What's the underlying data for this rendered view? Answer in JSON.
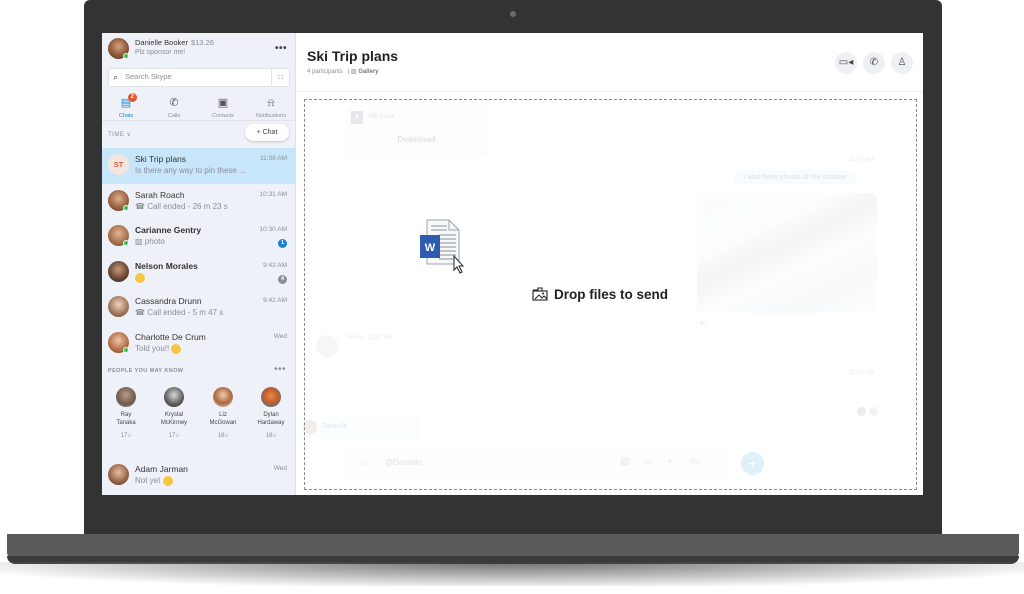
{
  "device": {
    "type": "laptop"
  },
  "profile": {
    "name": "Danielle Booker",
    "credit": "$13.26",
    "mood": "Plz sponsor me!",
    "more_icon": "ellipsis-icon",
    "more_label": "•••"
  },
  "search": {
    "placeholder": "Search Skype",
    "icon": "search-icon",
    "dialpad_icon": "dialpad-icon"
  },
  "nav_tabs": [
    {
      "label": "Chats",
      "icon": "chat-icon",
      "badge": "2",
      "active": true
    },
    {
      "label": "Calls",
      "icon": "phone-icon",
      "active": false
    },
    {
      "label": "Contacts",
      "icon": "contacts-icon",
      "active": false
    },
    {
      "label": "Notifications",
      "icon": "bell-icon",
      "active": false
    }
  ],
  "sort": {
    "label": "TIME",
    "new_chat_label": "+ Chat"
  },
  "chats": [
    {
      "name": "Ski Trip plans",
      "initials": "ST",
      "preview": "Is there any way to pin these ...",
      "time": "11:08 AM",
      "selected": true,
      "bold": false
    },
    {
      "name": "Sarah Roach",
      "preview": "Call ended - 26 m 23 s",
      "preview_icon": "call-ended-icon",
      "time": "10:31 AM",
      "online": true
    },
    {
      "name": "Carianne Gentry",
      "preview": "photo",
      "preview_icon": "image-icon",
      "time": "10:30 AM",
      "online": true,
      "bold": true,
      "unread": "1",
      "unread_color": "#1a83d6"
    },
    {
      "name": "Nelson Morales",
      "preview": "",
      "preview_icon": "emoji-icon",
      "time": "9:42 AM",
      "bold": true,
      "unread": "4",
      "unread_color": "#8a8f95"
    },
    {
      "name": "Cassandra Drunn",
      "preview": "Call ended - 5 m 47 s",
      "preview_icon": "call-ended-icon",
      "time": "9:42 AM"
    },
    {
      "name": "Charlotte De Crum",
      "preview": "Told you!!",
      "preview_icon": "emoji-icon",
      "time": "Wed",
      "online": true
    }
  ],
  "people_you_may_know": {
    "label": "PEOPLE YOU MAY KNOW",
    "people": [
      {
        "first": "Ray",
        "last": "Tanaka",
        "mutual": "17"
      },
      {
        "first": "Krystal",
        "last": "McKinney",
        "mutual": "17"
      },
      {
        "first": "Liz",
        "last": "McGowan",
        "mutual": "18"
      },
      {
        "first": "Dylan",
        "last": "Hardaway",
        "mutual": "18"
      }
    ]
  },
  "chat_after_pymk": {
    "name": "Adam Jarman",
    "preview": "Not yet",
    "time": "Wed"
  },
  "conversation": {
    "title": "Ski Trip plans",
    "participants": "4 participants",
    "gallery_label": "Gallery",
    "header_buttons": [
      "video-call-icon",
      "phone-icon",
      "add-person-icon"
    ],
    "file_card": {
      "name": "MS Excel",
      "action": "Download"
    },
    "messages": [
      {
        "time": "11:07 AM",
        "text": "I also have photos of the location",
        "outgoing": true
      },
      {
        "type": "photo",
        "reaction": "heart",
        "reaction_count": "1"
      },
      {
        "sender": "Serena, 11:07 AM",
        "incoming": true
      },
      {
        "time": "11:08 AM"
      }
    ],
    "mention_suggestion": "Danielle",
    "compose_value": "@Danielle",
    "drop_overlay": {
      "label": "Drop files to send",
      "dragged_file": "word-document-icon"
    }
  }
}
